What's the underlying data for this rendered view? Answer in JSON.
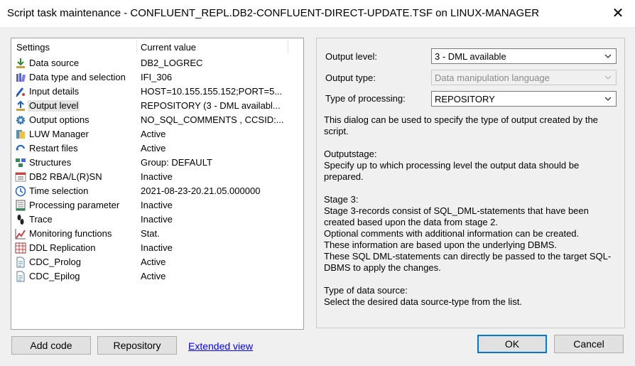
{
  "window": {
    "title": "Script task maintenance - CONFLUENT_REPL.DB2-CONFLUENT-DIRECT-UPDATE.TSF on LINUX-MANAGER",
    "close_glyph": "✕"
  },
  "settings_list": {
    "header_settings": "Settings",
    "header_value": "Current value",
    "rows": [
      {
        "label": "Data source",
        "value": "DB2_LOGREC",
        "icon": "download-arrow-icon"
      },
      {
        "label": "Data type and selection",
        "value": "IFI_306",
        "icon": "books-icon"
      },
      {
        "label": "Input details",
        "value": "HOST=10.155.155.152;PORT=5...",
        "icon": "pen-icon"
      },
      {
        "label": "Output level",
        "value": "REPOSITORY (3 - DML availabl...",
        "icon": "upload-arrow-icon"
      },
      {
        "label": "Output options",
        "value": "NO_SQL_COMMENTS , CCSID:...",
        "icon": "gear-icon"
      },
      {
        "label": "LUW Manager",
        "value": "Active",
        "icon": "luw-manager-icon"
      },
      {
        "label": "Restart files",
        "value": "Active",
        "icon": "restart-arrow-icon"
      },
      {
        "label": "Structures",
        "value": "Group: DEFAULT",
        "icon": "structure-icon"
      },
      {
        "label": "DB2 RBA/L(R)SN",
        "value": "Inactive",
        "icon": "db2-icon"
      },
      {
        "label": "Time selection",
        "value": "2021-08-23-20.21.05.000000",
        "icon": "clock-icon"
      },
      {
        "label": "Processing parameter",
        "value": "Inactive",
        "icon": "document-icon"
      },
      {
        "label": "Trace",
        "value": "Inactive",
        "icon": "footprint-icon"
      },
      {
        "label": "Monitoring functions",
        "value": "Stat.",
        "icon": "chart-icon"
      },
      {
        "label": "DDL Replication",
        "value": "Inactive",
        "icon": "table-grid-icon"
      },
      {
        "label": "CDC_Prolog",
        "value": "Active",
        "icon": "script-file-icon"
      },
      {
        "label": "CDC_Epilog",
        "value": "Active",
        "icon": "script-file-icon"
      }
    ],
    "selected_index": 3
  },
  "output_panel": {
    "output_level_label": "Output level:",
    "output_level_value": "3 - DML available",
    "output_type_label": "Output type:",
    "output_type_value": "Data manipulation language",
    "processing_label": "Type of processing:",
    "processing_value": "REPOSITORY",
    "description": [
      [
        "This dialog can be used to specify the type of output created by the script."
      ],
      [
        "Outputstage:",
        "Specify up to which processing level the output data should be prepared."
      ],
      [
        "Stage 3:",
        "Stage 3-records consist of SQL_DML-statements that have been created based upon the data from stage 2.",
        "Optional comments with additional information can be created.",
        "These information are based upon the underlying DBMS.",
        "These SQL DML-statements can directly be passed to the target SQL-DBMS to apply the changes."
      ],
      [
        "Type of data source:",
        "Select the desired data source-type from the list."
      ]
    ]
  },
  "buttons": {
    "add_code": "Add code",
    "repository": "Repository",
    "extended_view": "Extended view",
    "ok": "OK",
    "cancel": "Cancel"
  },
  "colors": {
    "selection": "#e5e5e5",
    "link": "#0000ff",
    "default_button_border": "#0078d7"
  }
}
